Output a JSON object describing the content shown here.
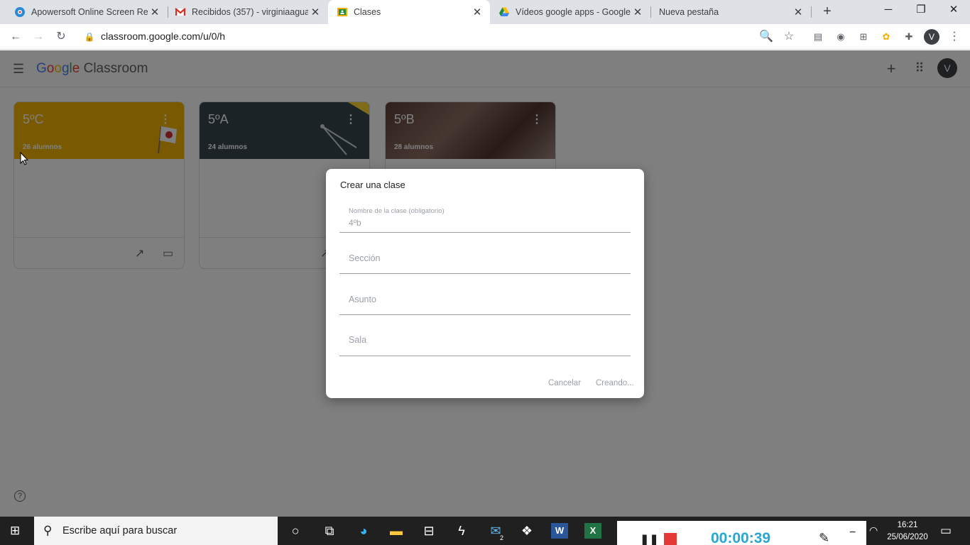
{
  "browser": {
    "tabs": [
      {
        "title": "Apowersoft Online Screen Rec",
        "favicon": "apowersoft-icon",
        "active": false
      },
      {
        "title": "Recibidos (357) - virginiaaguad",
        "favicon": "gmail-icon",
        "active": false
      },
      {
        "title": "Clases",
        "favicon": "classroom-icon",
        "active": true
      },
      {
        "title": "Vídeos google apps - Google",
        "favicon": "drive-icon",
        "active": false
      },
      {
        "title": "Nueva pestaña",
        "favicon": "",
        "active": false
      }
    ],
    "url": "classroom.google.com/u/0/h",
    "profile_initial": "V"
  },
  "app": {
    "logo_google": "Google",
    "logo_classroom": "Classroom",
    "avatar_initial": "V"
  },
  "classes": [
    {
      "name": "5ºC",
      "students": "26 alumnos",
      "color": "#f4b400"
    },
    {
      "name": "5ºA",
      "students": "24 alumnos",
      "color": "#37474f"
    },
    {
      "name": "5ºB",
      "students": "28 alumnos",
      "color": "#6d4c41"
    }
  ],
  "dialog": {
    "title": "Crear una clase",
    "name_label": "Nombre de la clase (obligatorio)",
    "name_value": "4ºb",
    "section_placeholder": "Sección",
    "subject_placeholder": "Asunto",
    "room_placeholder": "Sala",
    "cancel": "Cancelar",
    "create": "Creando..."
  },
  "taskbar": {
    "search_placeholder": "Escribe aquí para buscar",
    "mail_badge": "2",
    "recorder_time": "00:00:39",
    "time": "16:21",
    "date": "25/06/2020"
  },
  "colors": {
    "accent": "#1a73e8",
    "recorder_timer": "#27a7d2",
    "stop": "#e53935"
  }
}
